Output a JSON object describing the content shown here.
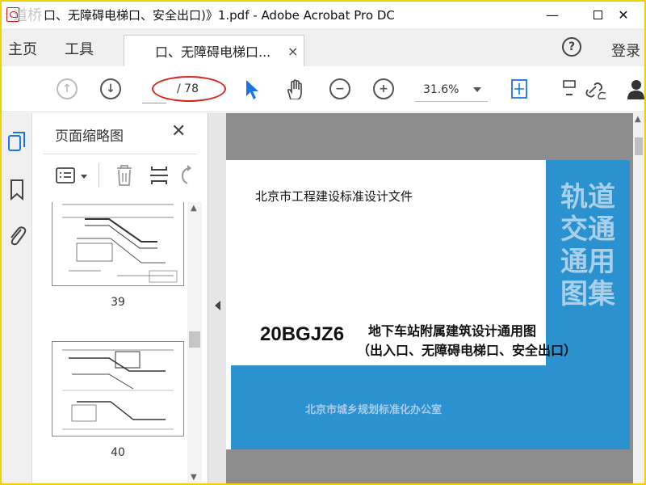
{
  "window": {
    "title": "口、无障碍电梯口、安全出口)》1.pdf - Adobe Acrobat Pro DC",
    "watermark": "道桥",
    "minimize": "—",
    "close": "✕"
  },
  "tabs": {
    "home": "主页",
    "tools": "工具",
    "document": "口、无障碍电梯口...",
    "document_close": "×",
    "help": "?",
    "login": "登录"
  },
  "toolbar": {
    "page_label": "/ 78",
    "zoom": "31.6%",
    "icons": [
      "page-up-icon",
      "page-down-icon",
      "select-arrow-icon",
      "hand-icon",
      "zoom-out-icon",
      "zoom-in-icon",
      "fit-page-icon",
      "comment-icon",
      "link-icon",
      "user-icon"
    ]
  },
  "sidebar": {
    "title": "页面缩略图",
    "close": "✕",
    "thumbnails": [
      {
        "number": "39"
      },
      {
        "number": "40"
      }
    ]
  },
  "document": {
    "header": "北京市工程建设标准设计文件",
    "code": "20BGJZ6",
    "subtitle_1": "地下车站附属建筑设计通用图",
    "subtitle_2": "（出入口、无障碍电梯口、安全出口）",
    "vertical_title": "轨道交通通用图集",
    "office": "北京市城乡规划标准化办公室"
  },
  "colors": {
    "border_yellow": "#f2d100",
    "accent_blue": "#2b91cf",
    "oval_red": "#d9261c"
  }
}
